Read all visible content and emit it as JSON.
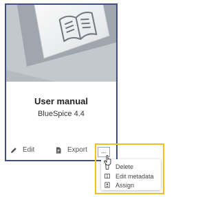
{
  "card": {
    "title": "User manual",
    "subtitle": "BlueSpice 4.4",
    "cover_icon": "open-book-key-icon",
    "actions": {
      "edit_label": "Edit",
      "export_label": "Export",
      "more_label": "..."
    }
  },
  "menu": {
    "items": [
      {
        "label": "Delete",
        "icon": "trash-icon"
      },
      {
        "label": "Edit metadata",
        "icon": "book-icon"
      },
      {
        "label": "Assign",
        "icon": "assign-icon"
      }
    ]
  },
  "colors": {
    "card_border": "#3f4d86",
    "highlight_border": "#f2c01e",
    "text": "#222222",
    "muted_text": "#555555"
  }
}
